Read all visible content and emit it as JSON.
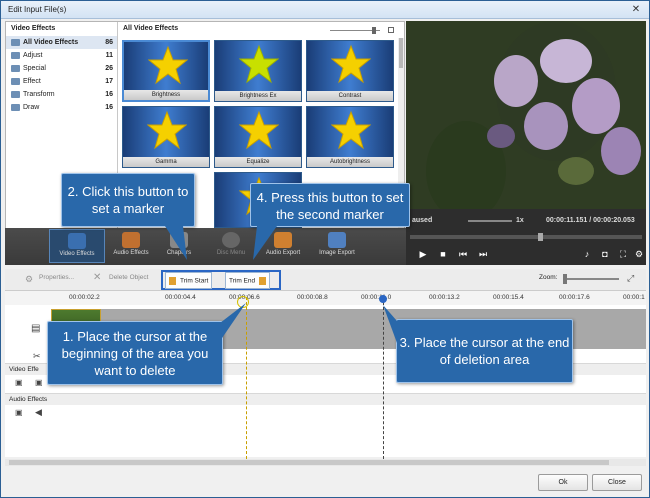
{
  "window": {
    "title": "Edit Input File(s)"
  },
  "categories": {
    "header": "Video Effects",
    "items": [
      {
        "label": "All Video Effects",
        "count": "86",
        "selected": true
      },
      {
        "label": "Adjust",
        "count": "11"
      },
      {
        "label": "Special",
        "count": "26"
      },
      {
        "label": "Effect",
        "count": "17"
      },
      {
        "label": "Transform",
        "count": "16"
      },
      {
        "label": "Draw",
        "count": "16"
      }
    ]
  },
  "effects_panel": {
    "header": "All Video Effects",
    "tiles": [
      "Brightness",
      "Brightness Ex",
      "Contrast",
      "Gamma",
      "Equalize",
      "Autobrightness"
    ]
  },
  "player": {
    "status": "aused",
    "speed": "1x",
    "time": "00:00:11.151 / 00:00:20.053"
  },
  "tabs": [
    "Video Effects",
    "Audio Effects",
    "Chapters",
    "Disc Menu",
    "Audio Export",
    "Image Export"
  ],
  "toolbar": {
    "properties": "Properties...",
    "delete": "Delete Object",
    "trim_start": "Trim Start",
    "trim_end": "Trim End",
    "zoom": "Zoom:"
  },
  "ruler": [
    "00:00:02.2",
    "00:00:04.4",
    "00:00:06.6",
    "00:00:08.8",
    "00:00:11.0",
    "00:00:13.2",
    "00:00:15.4",
    "00:00:17.6",
    "00:00:1"
  ],
  "tracks": {
    "video_effects": "Video Effe",
    "audio_effects": "Audio Effects"
  },
  "buttons": {
    "ok": "Ok",
    "close": "Close"
  },
  "callouts": {
    "c1": "1. Place the cursor at the beginning of the area you want to delete",
    "c2": "2. Click this button to set a marker",
    "c3": "3. Place the cursor at the end of deletion area",
    "c4": "4. Press this button to set the second marker"
  },
  "colors": {
    "accent": "#2968aa",
    "tile_blue": "#3f7dd0",
    "star": "#f5d000"
  }
}
